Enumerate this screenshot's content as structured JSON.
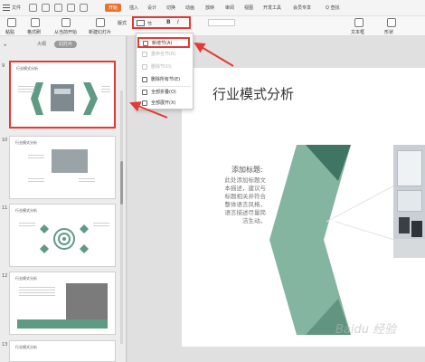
{
  "menubar": {
    "file_label": "文件",
    "tabs": [
      "开始",
      "插入",
      "设计",
      "切换",
      "动画",
      "放映",
      "审阅",
      "视图",
      "开发工具",
      "会员专享"
    ],
    "active_tab": "开始",
    "search_label": "Q 查找"
  },
  "ribbon": {
    "labels": [
      "粘贴",
      "格式刷",
      "从当前开始",
      "新建幻灯片",
      "版式",
      "节"
    ],
    "right_labels": [
      "文本框",
      "形状"
    ]
  },
  "left_panel": {
    "view_tabs": [
      "大纲",
      "幻灯片"
    ],
    "active_view": "幻灯片",
    "thumbnails": [
      {
        "number": "9",
        "title": "行业模式分析"
      },
      {
        "number": "10",
        "title": "行业模式分析"
      },
      {
        "number": "11",
        "title": "行业模式分析"
      },
      {
        "number": "12",
        "title": "行业模式分析"
      },
      {
        "number": "13",
        "title": "行业模式分析"
      }
    ]
  },
  "section_menu": {
    "items": [
      {
        "label": "新增节(A)",
        "enabled": true,
        "icon": "add-section-icon"
      },
      {
        "label": "重命名节(R)",
        "enabled": false,
        "icon": "rename-icon"
      },
      {
        "label": "删除节(D)",
        "enabled": false,
        "icon": "delete-icon"
      },
      {
        "label": "删除所有节(E)",
        "enabled": true,
        "icon": "delete-all-icon"
      },
      {
        "label": "全部折叠(O)",
        "enabled": true,
        "icon": "collapse-icon"
      },
      {
        "label": "全部展开(X)",
        "enabled": true,
        "icon": "expand-icon"
      }
    ]
  },
  "slide": {
    "title": "行业模式分析",
    "heading": "添加标题:",
    "body_lines": [
      "此处添加标题文",
      "本描述，建议与",
      "标题相关并符合",
      "整体语言风格，",
      "语言描述尽量简",
      "洁生动。"
    ]
  },
  "colors": {
    "accent": "#e9722c",
    "chevron_light": "#84b5a1",
    "chevron_dark": "#3f7562",
    "highlight": "#e53935"
  },
  "watermark": "Baidu 经验"
}
